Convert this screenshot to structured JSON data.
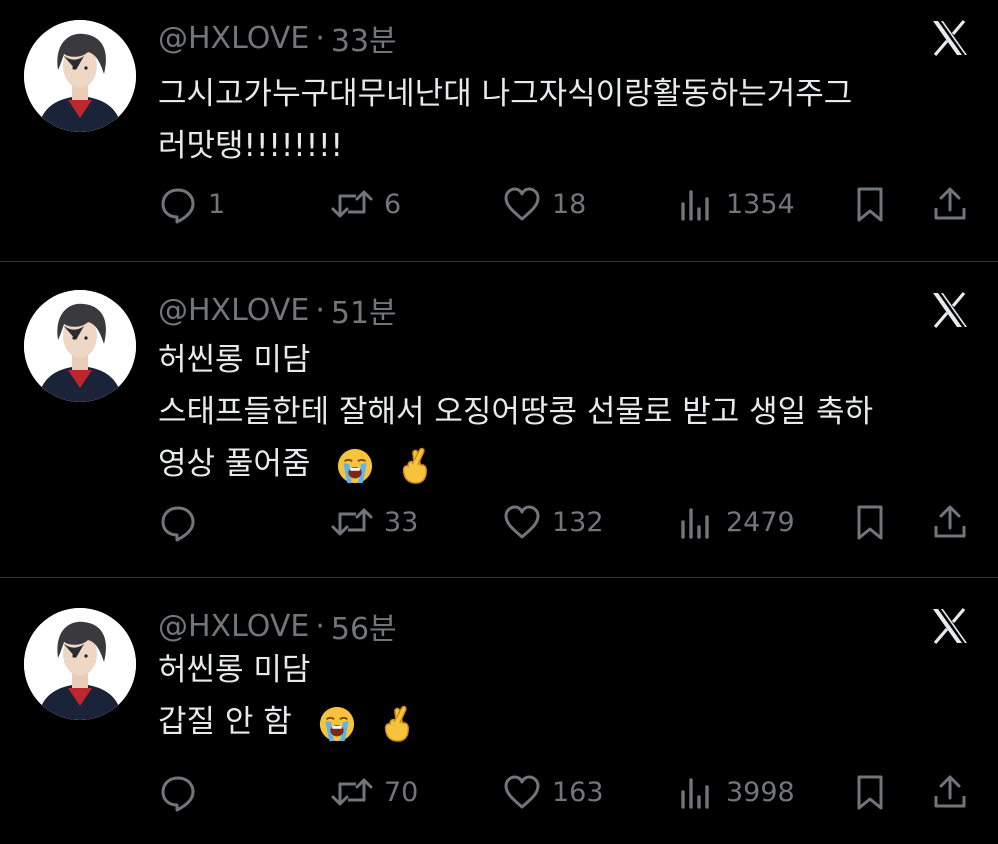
{
  "tweets": [
    {
      "handle": "@HXLOVE",
      "separator": "·",
      "time": "33분",
      "lines": [
        "그시고가누구대무네난대 나그자식이랑활동하는거주그",
        "러맛탱!!!!!!!!"
      ],
      "emojis": [],
      "replies": "1",
      "retweets": "6",
      "likes": "18",
      "views": "1354"
    },
    {
      "handle": "@HXLOVE",
      "separator": "·",
      "time": "51분",
      "lines": [
        "허씬롱 미담",
        "스태프들한테 잘해서 오징어땅콩 선물로 받고 생일 축하",
        "영상 풀어줌"
      ],
      "emojis": [
        "loudly-crying-face",
        "crossed-fingers"
      ],
      "replies": "",
      "retweets": "33",
      "likes": "132",
      "views": "2479"
    },
    {
      "handle": "@HXLOVE",
      "separator": "·",
      "time": "56분",
      "lines": [
        "허씬롱 미담",
        "갑질 안 함"
      ],
      "emojis": [
        "loudly-crying-face",
        "crossed-fingers"
      ],
      "replies": "",
      "retweets": "70",
      "likes": "163",
      "views": "3998"
    }
  ],
  "icons": {
    "logo": "x-logo-icon",
    "reply": "reply-icon",
    "retweet": "retweet-icon",
    "like": "heart-icon",
    "views": "views-icon",
    "bookmark": "bookmark-icon",
    "share": "share-icon"
  },
  "colors": {
    "background": "#000000",
    "text": "#e7e9ea",
    "secondary": "#71767b",
    "divider": "#2f3336"
  }
}
